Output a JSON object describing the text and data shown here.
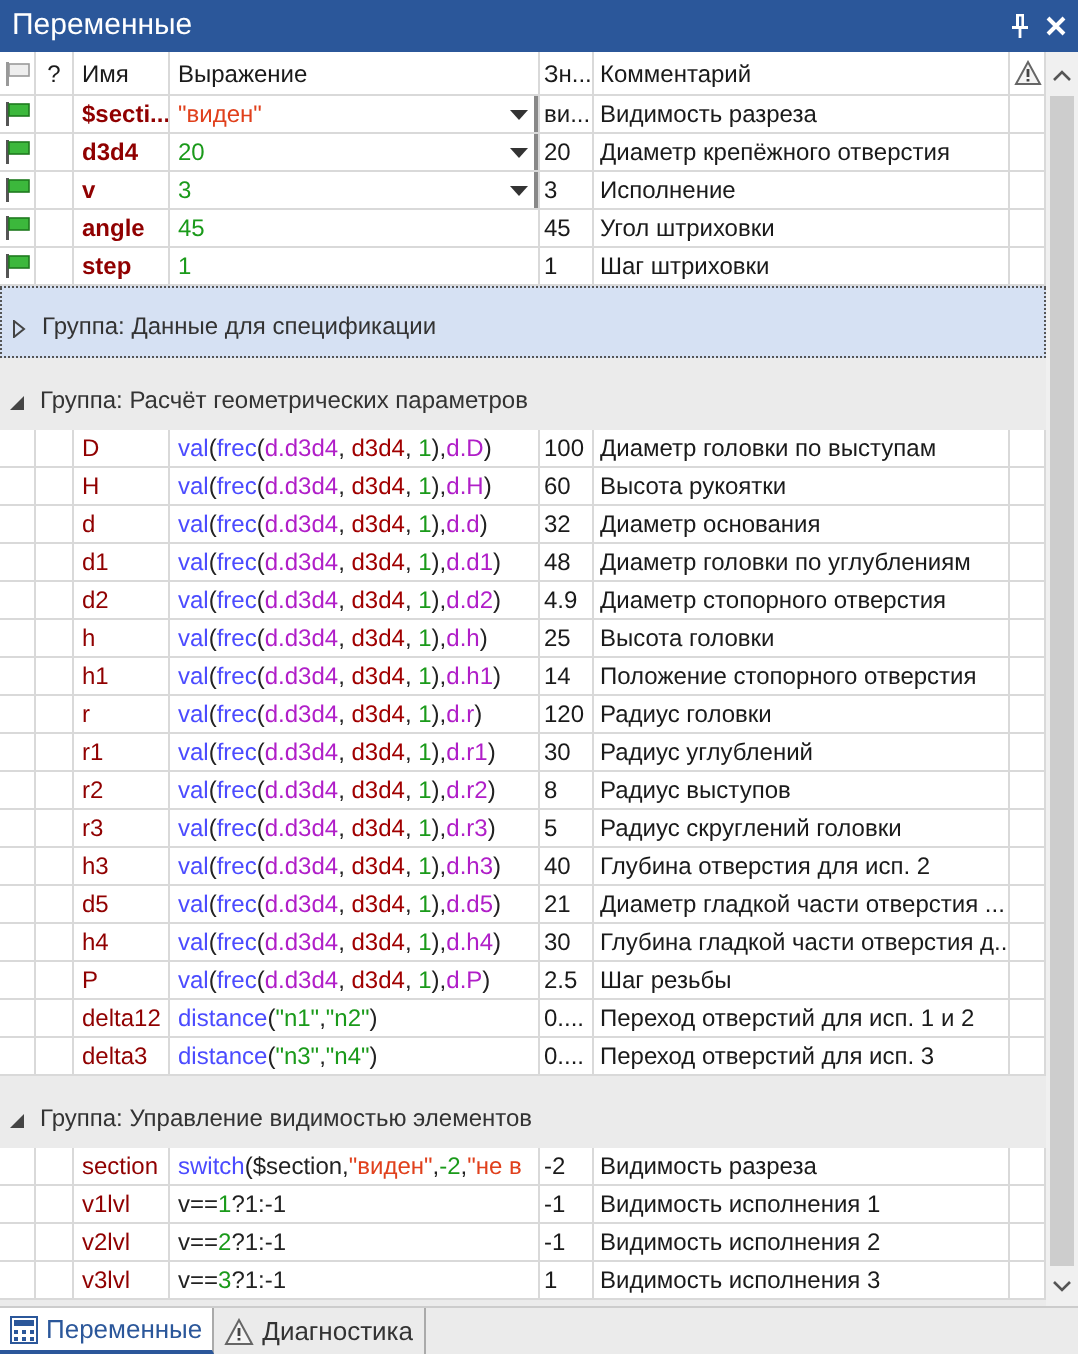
{
  "window": {
    "title": "Переменные"
  },
  "columns": {
    "column_2": "?",
    "name": "Имя",
    "expression": "Выражение",
    "value": "Зн...",
    "comment": "Комментарий"
  },
  "top_rows": [
    {
      "name": "$secti...",
      "dropdown": true,
      "expression": [
        {
          "kind": "string",
          "text": "\"виден\""
        }
      ],
      "value": "ви...",
      "comment": "Видимость разреза"
    },
    {
      "name": "d3d4",
      "dropdown": true,
      "expression": [
        {
          "kind": "number",
          "text": "20"
        }
      ],
      "value": "20",
      "comment": "Диаметр крепёжного отверстия"
    },
    {
      "name": "v",
      "dropdown": true,
      "expression": [
        {
          "kind": "number",
          "text": "3"
        }
      ],
      "value": "3",
      "comment": "Исполнение"
    },
    {
      "name": "angle",
      "dropdown": false,
      "expression": [
        {
          "kind": "number",
          "text": "45"
        }
      ],
      "value": "45",
      "comment": "Угол штриховки"
    },
    {
      "name": "step",
      "dropdown": false,
      "expression": [
        {
          "kind": "number",
          "text": "1"
        }
      ],
      "value": "1",
      "comment": "Шаг штриховки"
    }
  ],
  "groups": [
    {
      "title": "Группа: Данные для спецификации",
      "expanded": false,
      "selected": true
    },
    {
      "title": "Группа: Расчёт геометрических параметров",
      "expanded": true,
      "selected": false,
      "rows": [
        {
          "name": "D",
          "expression": [
            {
              "kind": "function",
              "text": "val"
            },
            {
              "kind": "plain",
              "text": "("
            },
            {
              "kind": "function",
              "text": "frec"
            },
            {
              "kind": "plain",
              "text": "("
            },
            {
              "kind": "field",
              "text": "d.d3d4"
            },
            {
              "kind": "plain",
              "text": ", "
            },
            {
              "kind": "variable",
              "text": "d3d4"
            },
            {
              "kind": "plain",
              "text": ", "
            },
            {
              "kind": "number",
              "text": "1"
            },
            {
              "kind": "plain",
              "text": "),"
            },
            {
              "kind": "field",
              "text": "d.D"
            },
            {
              "kind": "plain",
              "text": ")"
            }
          ],
          "value": "100",
          "comment": "Диаметр головки по выступам"
        },
        {
          "name": "H",
          "expression": [
            {
              "kind": "function",
              "text": "val"
            },
            {
              "kind": "plain",
              "text": "("
            },
            {
              "kind": "function",
              "text": "frec"
            },
            {
              "kind": "plain",
              "text": "("
            },
            {
              "kind": "field",
              "text": "d.d3d4"
            },
            {
              "kind": "plain",
              "text": ", "
            },
            {
              "kind": "variable",
              "text": "d3d4"
            },
            {
              "kind": "plain",
              "text": ", "
            },
            {
              "kind": "number",
              "text": "1"
            },
            {
              "kind": "plain",
              "text": "),"
            },
            {
              "kind": "field",
              "text": "d.H"
            },
            {
              "kind": "plain",
              "text": ")"
            }
          ],
          "value": "60",
          "comment": "Высота рукоятки"
        },
        {
          "name": "d",
          "expression": [
            {
              "kind": "function",
              "text": "val"
            },
            {
              "kind": "plain",
              "text": "("
            },
            {
              "kind": "function",
              "text": "frec"
            },
            {
              "kind": "plain",
              "text": "("
            },
            {
              "kind": "field",
              "text": "d.d3d4"
            },
            {
              "kind": "plain",
              "text": ", "
            },
            {
              "kind": "variable",
              "text": "d3d4"
            },
            {
              "kind": "plain",
              "text": ", "
            },
            {
              "kind": "number",
              "text": "1"
            },
            {
              "kind": "plain",
              "text": "),"
            },
            {
              "kind": "field",
              "text": "d.d"
            },
            {
              "kind": "plain",
              "text": ")"
            }
          ],
          "value": "32",
          "comment": "Диаметр основания"
        },
        {
          "name": "d1",
          "expression": [
            {
              "kind": "function",
              "text": "val"
            },
            {
              "kind": "plain",
              "text": "("
            },
            {
              "kind": "function",
              "text": "frec"
            },
            {
              "kind": "plain",
              "text": "("
            },
            {
              "kind": "field",
              "text": "d.d3d4"
            },
            {
              "kind": "plain",
              "text": ", "
            },
            {
              "kind": "variable",
              "text": "d3d4"
            },
            {
              "kind": "plain",
              "text": ", "
            },
            {
              "kind": "number",
              "text": "1"
            },
            {
              "kind": "plain",
              "text": "),"
            },
            {
              "kind": "field",
              "text": "d.d1"
            },
            {
              "kind": "plain",
              "text": ")"
            }
          ],
          "value": "48",
          "comment": "Диаметр головки по углублениям"
        },
        {
          "name": "d2",
          "expression": [
            {
              "kind": "function",
              "text": "val"
            },
            {
              "kind": "plain",
              "text": "("
            },
            {
              "kind": "function",
              "text": "frec"
            },
            {
              "kind": "plain",
              "text": "("
            },
            {
              "kind": "field",
              "text": "d.d3d4"
            },
            {
              "kind": "plain",
              "text": ", "
            },
            {
              "kind": "variable",
              "text": "d3d4"
            },
            {
              "kind": "plain",
              "text": ", "
            },
            {
              "kind": "number",
              "text": "1"
            },
            {
              "kind": "plain",
              "text": "),"
            },
            {
              "kind": "field",
              "text": "d.d2"
            },
            {
              "kind": "plain",
              "text": ")"
            }
          ],
          "value": "4.9",
          "comment": "Диаметр стопорного отверстия"
        },
        {
          "name": "h",
          "expression": [
            {
              "kind": "function",
              "text": "val"
            },
            {
              "kind": "plain",
              "text": "("
            },
            {
              "kind": "function",
              "text": "frec"
            },
            {
              "kind": "plain",
              "text": "("
            },
            {
              "kind": "field",
              "text": "d.d3d4"
            },
            {
              "kind": "plain",
              "text": ", "
            },
            {
              "kind": "variable",
              "text": "d3d4"
            },
            {
              "kind": "plain",
              "text": ", "
            },
            {
              "kind": "number",
              "text": "1"
            },
            {
              "kind": "plain",
              "text": "),"
            },
            {
              "kind": "field",
              "text": "d.h"
            },
            {
              "kind": "plain",
              "text": ")"
            }
          ],
          "value": "25",
          "comment": "Высота головки"
        },
        {
          "name": "h1",
          "expression": [
            {
              "kind": "function",
              "text": "val"
            },
            {
              "kind": "plain",
              "text": "("
            },
            {
              "kind": "function",
              "text": "frec"
            },
            {
              "kind": "plain",
              "text": "("
            },
            {
              "kind": "field",
              "text": "d.d3d4"
            },
            {
              "kind": "plain",
              "text": ", "
            },
            {
              "kind": "variable",
              "text": "d3d4"
            },
            {
              "kind": "plain",
              "text": ", "
            },
            {
              "kind": "number",
              "text": "1"
            },
            {
              "kind": "plain",
              "text": "),"
            },
            {
              "kind": "field",
              "text": "d.h1"
            },
            {
              "kind": "plain",
              "text": ")"
            }
          ],
          "value": "14",
          "comment": "Положение стопорного отверстия"
        },
        {
          "name": "r",
          "expression": [
            {
              "kind": "function",
              "text": "val"
            },
            {
              "kind": "plain",
              "text": "("
            },
            {
              "kind": "function",
              "text": "frec"
            },
            {
              "kind": "plain",
              "text": "("
            },
            {
              "kind": "field",
              "text": "d.d3d4"
            },
            {
              "kind": "plain",
              "text": ", "
            },
            {
              "kind": "variable",
              "text": "d3d4"
            },
            {
              "kind": "plain",
              "text": ", "
            },
            {
              "kind": "number",
              "text": "1"
            },
            {
              "kind": "plain",
              "text": "),"
            },
            {
              "kind": "field",
              "text": "d.r"
            },
            {
              "kind": "plain",
              "text": ")"
            }
          ],
          "value": "120",
          "comment": "Радиус головки"
        },
        {
          "name": "r1",
          "expression": [
            {
              "kind": "function",
              "text": "val"
            },
            {
              "kind": "plain",
              "text": "("
            },
            {
              "kind": "function",
              "text": "frec"
            },
            {
              "kind": "plain",
              "text": "("
            },
            {
              "kind": "field",
              "text": "d.d3d4"
            },
            {
              "kind": "plain",
              "text": ", "
            },
            {
              "kind": "variable",
              "text": "d3d4"
            },
            {
              "kind": "plain",
              "text": ", "
            },
            {
              "kind": "number",
              "text": "1"
            },
            {
              "kind": "plain",
              "text": "),"
            },
            {
              "kind": "field",
              "text": "d.r1"
            },
            {
              "kind": "plain",
              "text": ")"
            }
          ],
          "value": "30",
          "comment": "Радиус углублений"
        },
        {
          "name": "r2",
          "expression": [
            {
              "kind": "function",
              "text": "val"
            },
            {
              "kind": "plain",
              "text": "("
            },
            {
              "kind": "function",
              "text": "frec"
            },
            {
              "kind": "plain",
              "text": "("
            },
            {
              "kind": "field",
              "text": "d.d3d4"
            },
            {
              "kind": "plain",
              "text": ", "
            },
            {
              "kind": "variable",
              "text": "d3d4"
            },
            {
              "kind": "plain",
              "text": ", "
            },
            {
              "kind": "number",
              "text": "1"
            },
            {
              "kind": "plain",
              "text": "),"
            },
            {
              "kind": "field",
              "text": "d.r2"
            },
            {
              "kind": "plain",
              "text": ")"
            }
          ],
          "value": "8",
          "comment": "Радиус выступов"
        },
        {
          "name": "r3",
          "expression": [
            {
              "kind": "function",
              "text": "val"
            },
            {
              "kind": "plain",
              "text": "("
            },
            {
              "kind": "function",
              "text": "frec"
            },
            {
              "kind": "plain",
              "text": "("
            },
            {
              "kind": "field",
              "text": "d.d3d4"
            },
            {
              "kind": "plain",
              "text": ", "
            },
            {
              "kind": "variable",
              "text": "d3d4"
            },
            {
              "kind": "plain",
              "text": ", "
            },
            {
              "kind": "number",
              "text": "1"
            },
            {
              "kind": "plain",
              "text": "),"
            },
            {
              "kind": "field",
              "text": "d.r3"
            },
            {
              "kind": "plain",
              "text": ")"
            }
          ],
          "value": "5",
          "comment": "Радиус скруглений головки"
        },
        {
          "name": "h3",
          "expression": [
            {
              "kind": "function",
              "text": "val"
            },
            {
              "kind": "plain",
              "text": "("
            },
            {
              "kind": "function",
              "text": "frec"
            },
            {
              "kind": "plain",
              "text": "("
            },
            {
              "kind": "field",
              "text": "d.d3d4"
            },
            {
              "kind": "plain",
              "text": ", "
            },
            {
              "kind": "variable",
              "text": "d3d4"
            },
            {
              "kind": "plain",
              "text": ", "
            },
            {
              "kind": "number",
              "text": "1"
            },
            {
              "kind": "plain",
              "text": "),"
            },
            {
              "kind": "field",
              "text": "d.h3"
            },
            {
              "kind": "plain",
              "text": ")"
            }
          ],
          "value": "40",
          "comment": "Глубина отверстия для исп. 2"
        },
        {
          "name": "d5",
          "expression": [
            {
              "kind": "function",
              "text": "val"
            },
            {
              "kind": "plain",
              "text": "("
            },
            {
              "kind": "function",
              "text": "frec"
            },
            {
              "kind": "plain",
              "text": "("
            },
            {
              "kind": "field",
              "text": "d.d3d4"
            },
            {
              "kind": "plain",
              "text": ", "
            },
            {
              "kind": "variable",
              "text": "d3d4"
            },
            {
              "kind": "plain",
              "text": ", "
            },
            {
              "kind": "number",
              "text": "1"
            },
            {
              "kind": "plain",
              "text": "),"
            },
            {
              "kind": "field",
              "text": "d.d5"
            },
            {
              "kind": "plain",
              "text": ")"
            }
          ],
          "value": "21",
          "comment": "Диаметр гладкой части отверстия ..."
        },
        {
          "name": "h4",
          "expression": [
            {
              "kind": "function",
              "text": "val"
            },
            {
              "kind": "plain",
              "text": "("
            },
            {
              "kind": "function",
              "text": "frec"
            },
            {
              "kind": "plain",
              "text": "("
            },
            {
              "kind": "field",
              "text": "d.d3d4"
            },
            {
              "kind": "plain",
              "text": ", "
            },
            {
              "kind": "variable",
              "text": "d3d4"
            },
            {
              "kind": "plain",
              "text": ", "
            },
            {
              "kind": "number",
              "text": "1"
            },
            {
              "kind": "plain",
              "text": "),"
            },
            {
              "kind": "field",
              "text": "d.h4"
            },
            {
              "kind": "plain",
              "text": ")"
            }
          ],
          "value": "30",
          "comment": "Глубина гладкой части отверстия д..."
        },
        {
          "name": "P",
          "expression": [
            {
              "kind": "function",
              "text": "val"
            },
            {
              "kind": "plain",
              "text": "("
            },
            {
              "kind": "function",
              "text": "frec"
            },
            {
              "kind": "plain",
              "text": "("
            },
            {
              "kind": "field",
              "text": "d.d3d4"
            },
            {
              "kind": "plain",
              "text": ", "
            },
            {
              "kind": "variable",
              "text": "d3d4"
            },
            {
              "kind": "plain",
              "text": ", "
            },
            {
              "kind": "number",
              "text": "1"
            },
            {
              "kind": "plain",
              "text": "),"
            },
            {
              "kind": "field",
              "text": "d.P"
            },
            {
              "kind": "plain",
              "text": ")"
            }
          ],
          "value": "2.5",
          "comment": "Шаг резьбы"
        },
        {
          "name": "delta12",
          "expression": [
            {
              "kind": "function",
              "text": "distance"
            },
            {
              "kind": "plain",
              "text": "("
            },
            {
              "kind": "node",
              "text": "\"n1\""
            },
            {
              "kind": "plain",
              "text": ","
            },
            {
              "kind": "node",
              "text": "\"n2\""
            },
            {
              "kind": "plain",
              "text": ")"
            }
          ],
          "value": "0....",
          "comment": "Переход отверстий для исп. 1 и 2"
        },
        {
          "name": "delta3",
          "expression": [
            {
              "kind": "function",
              "text": "distance"
            },
            {
              "kind": "plain",
              "text": "("
            },
            {
              "kind": "node",
              "text": "\"n3\""
            },
            {
              "kind": "plain",
              "text": ","
            },
            {
              "kind": "node",
              "text": "\"n4\""
            },
            {
              "kind": "plain",
              "text": ")"
            }
          ],
          "value": "0....",
          "comment": "Переход отверстий для исп. 3"
        }
      ]
    },
    {
      "title": "Группа: Управление видимостью элементов",
      "expanded": true,
      "selected": false,
      "rows": [
        {
          "name": "section",
          "expression": [
            {
              "kind": "function",
              "text": "switch"
            },
            {
              "kind": "plain",
              "text": "($section,"
            },
            {
              "kind": "string",
              "text": "\"виден\""
            },
            {
              "kind": "plain",
              "text": ","
            },
            {
              "kind": "number",
              "text": "-2"
            },
            {
              "kind": "plain",
              "text": ","
            },
            {
              "kind": "string",
              "text": "\"не в"
            }
          ],
          "value": "-2",
          "comment": "Видимость разреза"
        },
        {
          "name": "v1lvl",
          "expression": [
            {
              "kind": "plain",
              "text": "v=="
            },
            {
              "kind": "number",
              "text": "1"
            },
            {
              "kind": "plain",
              "text": "?1:-1"
            }
          ],
          "value": "-1",
          "comment": "Видимость исполнения 1"
        },
        {
          "name": "v2lvl",
          "expression": [
            {
              "kind": "plain",
              "text": "v=="
            },
            {
              "kind": "number",
              "text": "2"
            },
            {
              "kind": "plain",
              "text": "?1:-1"
            }
          ],
          "value": "-1",
          "comment": "Видимость исполнения 2"
        },
        {
          "name": "v3lvl",
          "expression": [
            {
              "kind": "plain",
              "text": "v=="
            },
            {
              "kind": "number",
              "text": "3"
            },
            {
              "kind": "plain",
              "text": "?1:-1"
            }
          ],
          "value": "1",
          "comment": "Видимость исполнения 3"
        }
      ]
    }
  ],
  "tabs": [
    {
      "label": "Переменные",
      "selected": true
    },
    {
      "label": "Диагностика",
      "selected": false
    }
  ]
}
